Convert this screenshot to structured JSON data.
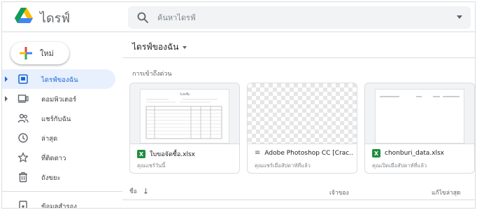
{
  "app": {
    "title": "ไดรฟ์"
  },
  "search": {
    "placeholder": "ค้นหาไดรฟ์"
  },
  "sidebar": {
    "new_label": "ใหม่",
    "items": [
      {
        "label": "ไดรฟ์ของฉัน",
        "icon": "my-drive-icon",
        "active": true,
        "expandable": true
      },
      {
        "label": "คอมพิวเตอร์",
        "icon": "computer-icon",
        "active": false,
        "expandable": true
      },
      {
        "label": "แชร์กับฉัน",
        "icon": "shared-icon",
        "active": false,
        "expandable": false
      },
      {
        "label": "ล่าสุด",
        "icon": "clock-icon",
        "active": false,
        "expandable": false
      },
      {
        "label": "ที่ติดดาว",
        "icon": "star-icon",
        "active": false,
        "expandable": false
      },
      {
        "label": "ถังขยะ",
        "icon": "trash-icon",
        "active": false,
        "expandable": false
      }
    ],
    "backup_label": "ข้อมูลสำรอง"
  },
  "main": {
    "title": "ไดรฟ์ของฉัน",
    "quick_access_label": "การเข้าถึงด่วน",
    "cards": [
      {
        "name": "ใบขอจัดซื้อ.xlsx",
        "meta": "คุณแชร์วันนี้",
        "type": "xlsx",
        "thumb_text": "ใบสั่งซื้อ"
      },
      {
        "name": "Adobe Photoshop CC [Crac...",
        "meta": "คุณแชร์เมื่อสัปดาห์ที่แล้ว",
        "type": "file"
      },
      {
        "name": "chonburi_data.xlsx",
        "meta": "คุณเปิดเมื่อสัปดาห์ที่แล้ว",
        "type": "xlsx"
      }
    ],
    "columns": {
      "name": "ชื่อ",
      "owner": "เจ้าของ",
      "modified": "แก้ไขล่าสุด"
    }
  },
  "colors": {
    "accent": "#1967d2",
    "active_bg": "#e8f0fe",
    "excel_green": "#1e8e3e"
  }
}
